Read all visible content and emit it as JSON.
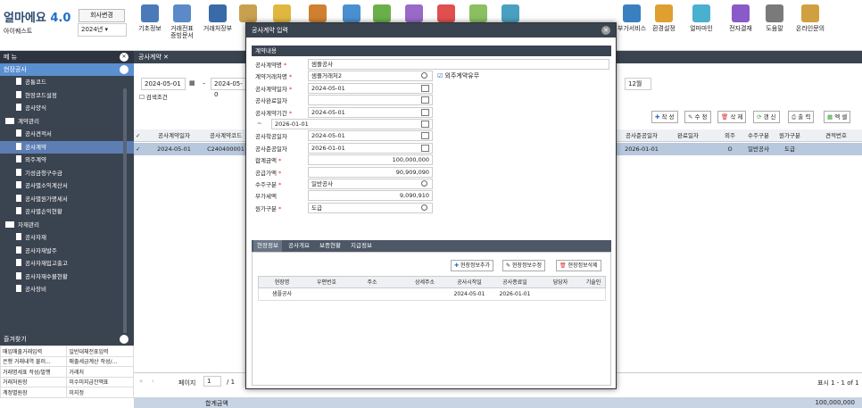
{
  "app": {
    "logo": "얼마에요",
    "version": "4.0",
    "company": "아이퀘스트",
    "change_company": "회사변경",
    "year": "2024년"
  },
  "toolbar": [
    "기초정보",
    "거래전표\n증빙문서",
    "거래처장부",
    "",
    "",
    "",
    "",
    "",
    "",
    "",
    "",
    "",
    "부가서비스",
    "환경설정",
    "얼마마인",
    "전자결재",
    "도움말",
    "온라인문의"
  ],
  "menu": {
    "title": "메 뉴",
    "section": "현장공사",
    "items": [
      "공통코드",
      "현장코드설정",
      "공사양식",
      "계약관리",
      "공사견적서",
      "공사계약",
      "외주계약",
      "기성금청구수금",
      "공사별소익계산서",
      "공사별원가명세서",
      "공사별손익현황",
      "자재관리",
      "공사자재",
      "공사자재발주",
      "공사자재입고출고",
      "공사자재수불현황",
      "공사장비"
    ]
  },
  "favorites": {
    "title": "즐겨찾기",
    "items": [
      [
        "매입매출거래입력",
        "일반대체전표입력"
      ],
      [
        "은행 거래내역 불러...",
        "매출세금계산 작성/..."
      ],
      [
        "거래명세표 작성/발행",
        "거래처"
      ],
      [
        "거래처원장",
        "미수미지급잔액표"
      ],
      [
        "계정별원장",
        "미지정"
      ]
    ]
  },
  "main": {
    "tab": "공사계약",
    "date_from": "2024-05-01",
    "date_to": "2024-05-0",
    "search_cond": "검색조건",
    "month": "12월",
    "actions": [
      "작 성",
      "수 정",
      "삭 제",
      "갱 신",
      "출 력",
      "엑 셀"
    ],
    "headers": [
      "공사계약일자",
      "공사계약코드",
      "공사준공일자",
      "완료일자",
      "외주",
      "수주구분",
      "원가구분",
      "견적번호"
    ],
    "row": [
      "2024-05-01",
      "C240400001",
      "2026-01-01",
      "",
      "O",
      "일반공사",
      "도급",
      ""
    ],
    "page_label": "페이지",
    "page": "1",
    "page_total": "/ 1",
    "count": "표시 1 - 1 of 1",
    "sum_label": "합계금액",
    "sum_value": "100,000,000"
  },
  "modal": {
    "title": "공사계약 입력",
    "section": "계약내용",
    "fields": [
      {
        "label": "공사계약명",
        "req": true,
        "value": "샘플공사"
      },
      {
        "label": "계약거래처명",
        "req": true,
        "value": "샘플거래처2",
        "extra": "외주계약유무"
      },
      {
        "label": "공사계약일자",
        "req": true,
        "value": "2024-05-01"
      },
      {
        "label": "공사완료일자",
        "req": false,
        "value": ""
      },
      {
        "label": "공사계약기간",
        "req": true,
        "value": "2024-05-01"
      },
      {
        "label": "~",
        "req": false,
        "value": "2026-01-01"
      },
      {
        "label": "공사착공일자",
        "req": false,
        "value": "2024-05-01"
      },
      {
        "label": "공사준공일자",
        "req": false,
        "value": "2026-01-01"
      },
      {
        "label": "합계금액",
        "req": true,
        "value": "100,000,000"
      },
      {
        "label": "공급가액",
        "req": true,
        "value": "90,909,090"
      },
      {
        "label": "수주구분",
        "req": true,
        "value": "일반공사"
      },
      {
        "label": "부가세액",
        "req": false,
        "value": "9,090,910"
      },
      {
        "label": "원가구분",
        "req": true,
        "value": "도급"
      }
    ],
    "subtabs": [
      "현장정보",
      "공사개요",
      "보증현황",
      "지급정보"
    ],
    "sub_buttons": [
      "현장정보추가",
      "현장정보수정",
      "현장정보삭제"
    ],
    "sub_headers": [
      "현장명",
      "우편번호",
      "주소",
      "상세주소",
      "공사시작일",
      "공사종료일",
      "담당자",
      "기술인"
    ],
    "sub_row": [
      "샘플공사",
      "",
      "",
      "",
      "2024-05-01",
      "2026-01-01",
      "",
      ""
    ]
  }
}
